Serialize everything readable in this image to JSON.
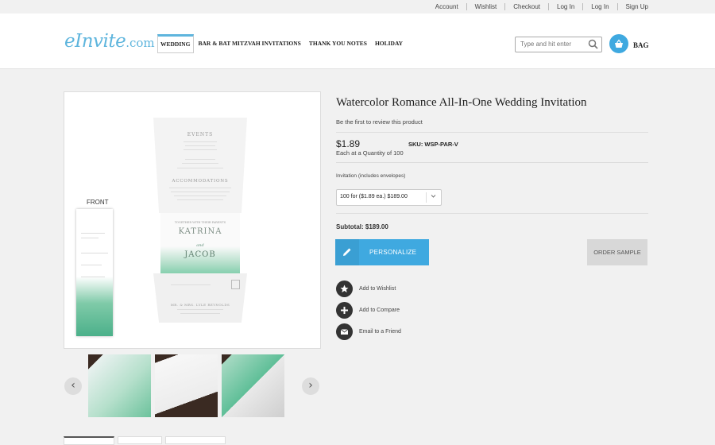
{
  "topbar": {
    "links": [
      "Account",
      "Wishlist",
      "Checkout",
      "Log In",
      "Log In",
      "Sign Up"
    ]
  },
  "header": {
    "logo_main": "eInvite",
    "logo_suffix": ".com",
    "nav": [
      "WEDDING",
      "BAR & BAT MITZVAH INVITATIONS",
      "THANK YOU NOTES",
      "HOLIDAY"
    ],
    "search_placeholder": "Type and hit enter",
    "bag_label": "BAG"
  },
  "gallery": {
    "front_label": "FRONT",
    "card": {
      "events": "EVENTS",
      "accommodations": "ACCOMMODATIONS",
      "together": "TOGETHER WITH THEIR PARENTS",
      "bride": "KATRINA",
      "and": "and",
      "groom": "JACOB",
      "reply": "MR. & MRS. LYLE REYNOLDS"
    },
    "prev": "‹",
    "next": "›"
  },
  "product": {
    "title": "Watercolor Romance All-In-One Wedding Invitation",
    "review_link": "Be the first to review this product",
    "price": "$1.89",
    "price_note": "Each at a Quantity of 100",
    "sku": "SKU: WSP-PAR-V",
    "option_label": "Invitation (includes envelopes)",
    "option_value": "100 for ($1.89 ea.) $189.00",
    "subtotal": "Subtotal: $189.00",
    "personalize_label": "PERSONALIZE",
    "sample_label": "ORDER SAMPLE",
    "actions": [
      "Add to Wishlist",
      "Add to Compare",
      "Email to a Friend"
    ]
  },
  "colors": {
    "accent": "#3fa9e0",
    "logo": "#5eb5dd",
    "watercolor": "#6cc29c"
  }
}
